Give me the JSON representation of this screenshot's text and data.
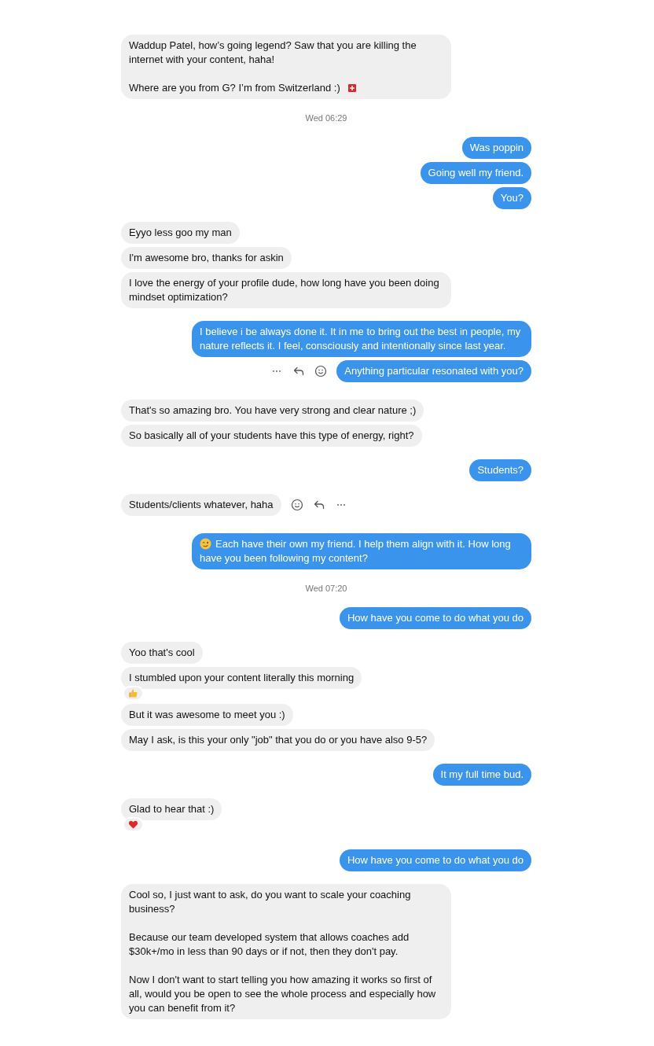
{
  "messages": [
    {
      "kind": "in",
      "text": "Waddup Patel, how’s going legend? Saw that you are killing the internet with your content, haha!\n\nWhere are you from G? I’m from Switzerland :)",
      "trailing_icon": {
        "kind": "flag"
      }
    },
    {
      "kind": "time",
      "text": "Wed 06:29"
    },
    {
      "kind": "out",
      "text": "Was poppin"
    },
    {
      "kind": "out",
      "text": "Going well my friend."
    },
    {
      "kind": "out",
      "text": "You?"
    },
    {
      "kind": "in",
      "text": "Eyyo less goo my man"
    },
    {
      "kind": "in",
      "text": "I'm awesome bro, thanks for askin"
    },
    {
      "kind": "in",
      "text": "I love the energy of your profile dude, how long have you been doing mindset optimization?"
    },
    {
      "kind": "out",
      "text": "I believe i be always done it. It in me to bring out the best in people, my nature reflects it. I feel, consciously and intentionally since last year."
    },
    {
      "kind": "out",
      "text": "Anything particular resonated with you?",
      "hover_actions": true
    },
    {
      "kind": "in",
      "text": "That's so amazing bro. You have very strong and clear nature ;)"
    },
    {
      "kind": "in",
      "text": "So basically all of your students have this type of energy, right?"
    },
    {
      "kind": "out",
      "text": "Students?"
    },
    {
      "kind": "in",
      "text": "Students/clients whatever, haha",
      "hover_actions": true
    },
    {
      "kind": "out",
      "text": "Each have their own my friend. I help them align with it. How long have you been following my content?",
      "leading_icon": {
        "kind": "wink"
      }
    },
    {
      "kind": "time",
      "text": "Wed 07:20"
    },
    {
      "kind": "out",
      "text": "How have you come to do what you do"
    },
    {
      "kind": "in",
      "text": "Yoo that's cool"
    },
    {
      "kind": "in",
      "text": "I stumbled upon your content literally this morning",
      "reaction": {
        "kind": "thumbs"
      }
    },
    {
      "kind": "in",
      "text": "But it was awesome to meet you :)"
    },
    {
      "kind": "in",
      "text": "May I ask, is this your only \"job\" that you do or you have also 9-5?"
    },
    {
      "kind": "out",
      "text": "It my full time bud."
    },
    {
      "kind": "in",
      "text": "Glad to hear that :)",
      "reaction": {
        "kind": "heart"
      }
    },
    {
      "kind": "out",
      "text": "How have you come to do what you do"
    },
    {
      "kind": "in",
      "text": "Cool so, I just want to ask, do you want to scale your coaching business?\n\nBecause our team developed system that allows coaches add $30k+/mo in less than 90 days or if not, then they don't pay.\n\nNow I don't want to start telling you how amazing it works so first of all, would you be open to see the whole process and especially how you can benefit from it?"
    }
  ]
}
